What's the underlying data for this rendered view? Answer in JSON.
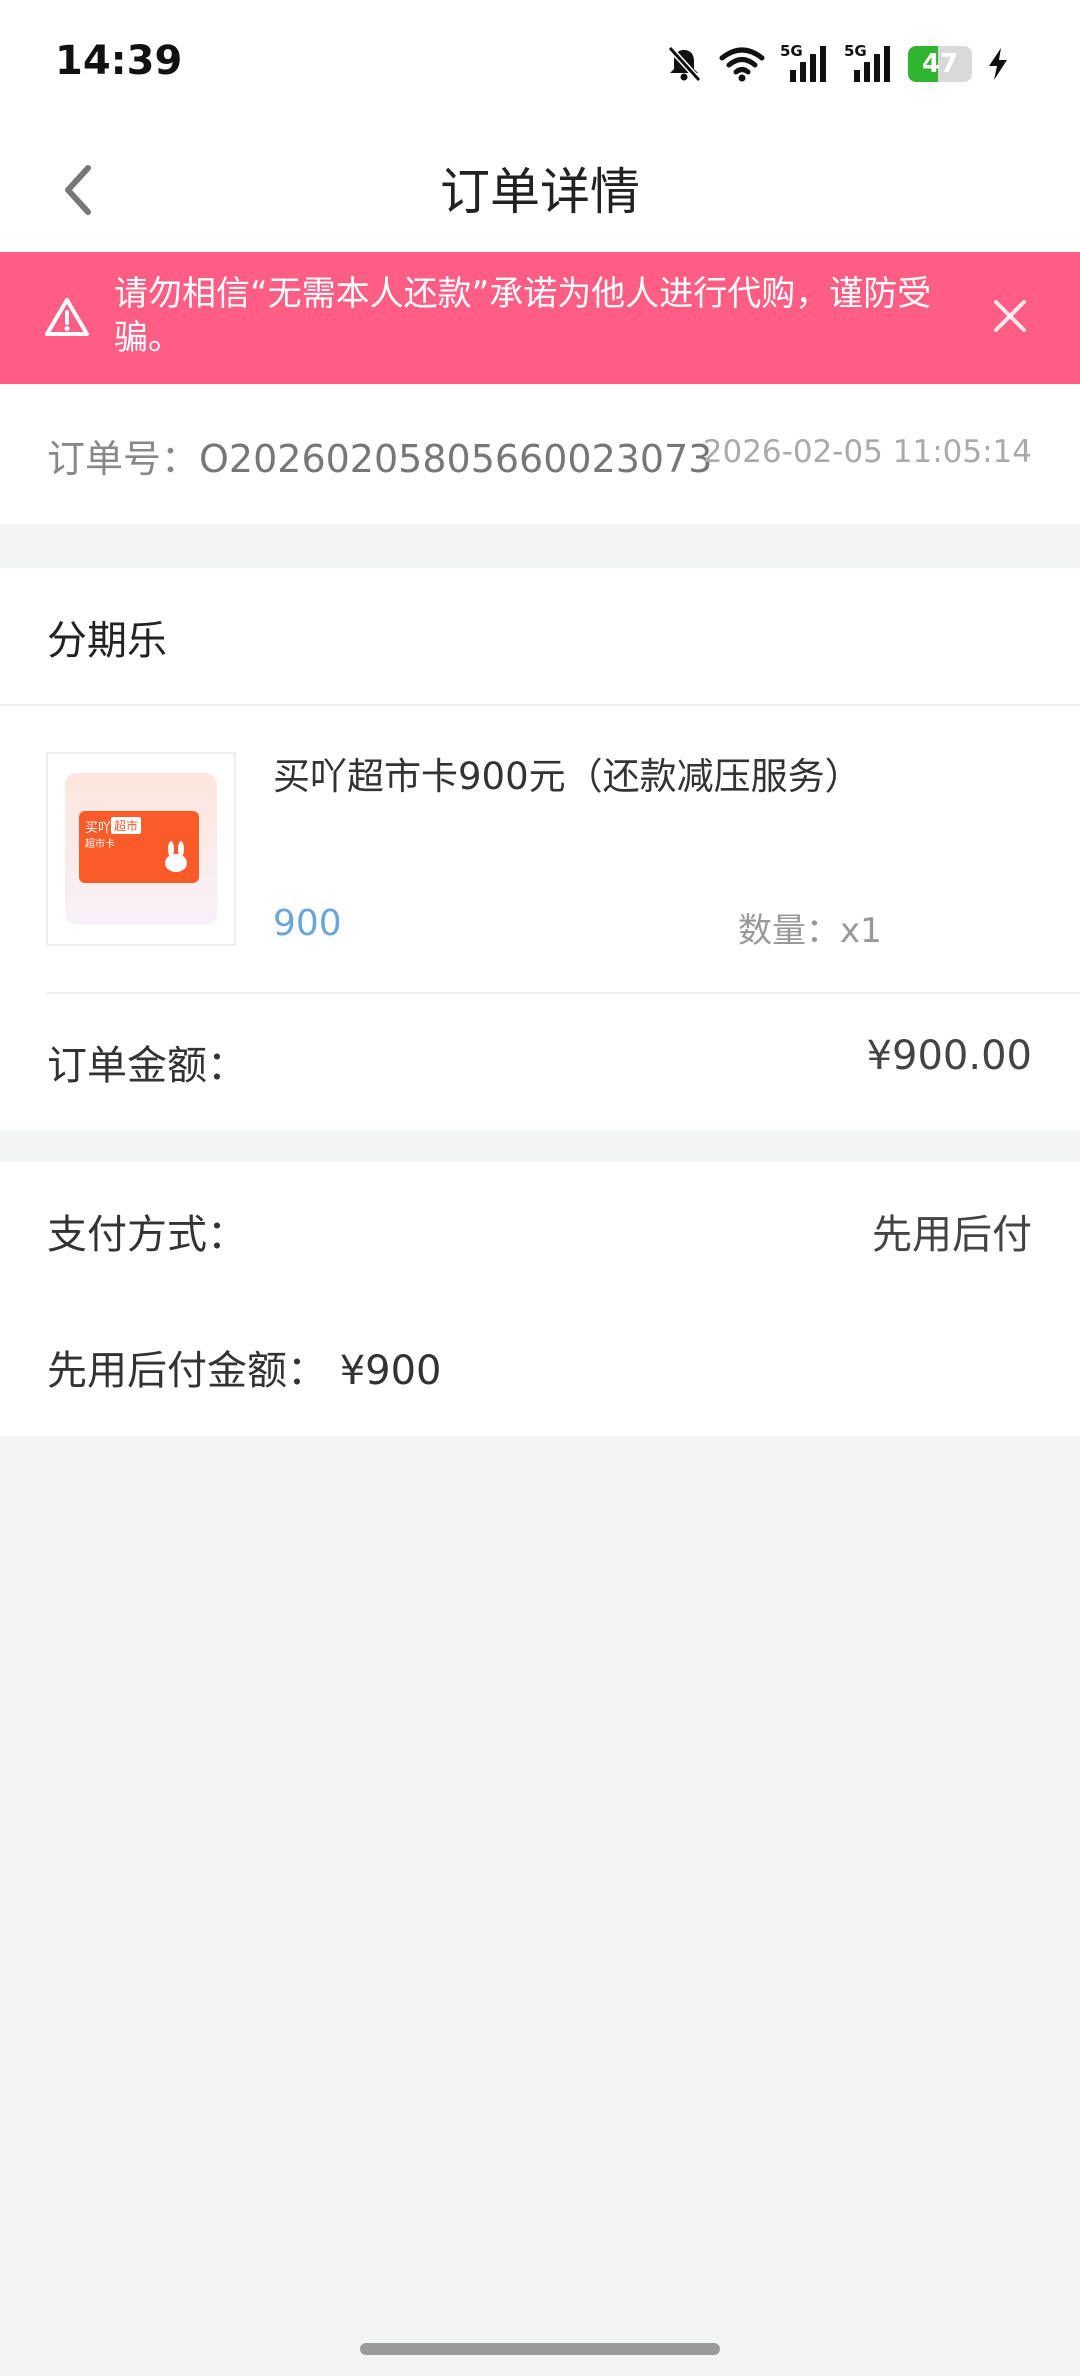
{
  "status_bar": {
    "time": "14:39",
    "network_1": "5G",
    "network_2": "5G",
    "battery_level": "47",
    "battery_percent": 47,
    "battery_color": "#2fb52f"
  },
  "nav": {
    "title": "订单详情",
    "back_icon": "chevron-left-icon"
  },
  "alert": {
    "text": "请勿相信“无需本人还款”承诺为他人进行代购，谨防受骗。",
    "background_color": "#ff5e84",
    "warning_icon": "warning-triangle-icon",
    "close_icon": "close-icon"
  },
  "order": {
    "number_label": "订单号：",
    "number_value": "O20260205805660023073",
    "time": "2026-02-05 11:05:14"
  },
  "product_card": {
    "store_name": "分期乐",
    "thumbnail_tag_1": "买吖",
    "thumbnail_tag_2": "超市",
    "thumbnail_sub": "超市卡",
    "product_title": "买吖超市卡900元（还款减压服务）",
    "price": "900",
    "price_color": "#6aa6d8",
    "quantity": "数量：x1",
    "amount_label": "订单金额：",
    "amount_value": "¥900.00"
  },
  "payment": {
    "method_label": "支付方式：",
    "method_value": "先用后付",
    "bnpl_amount": "先用后付金额：  ¥900"
  }
}
